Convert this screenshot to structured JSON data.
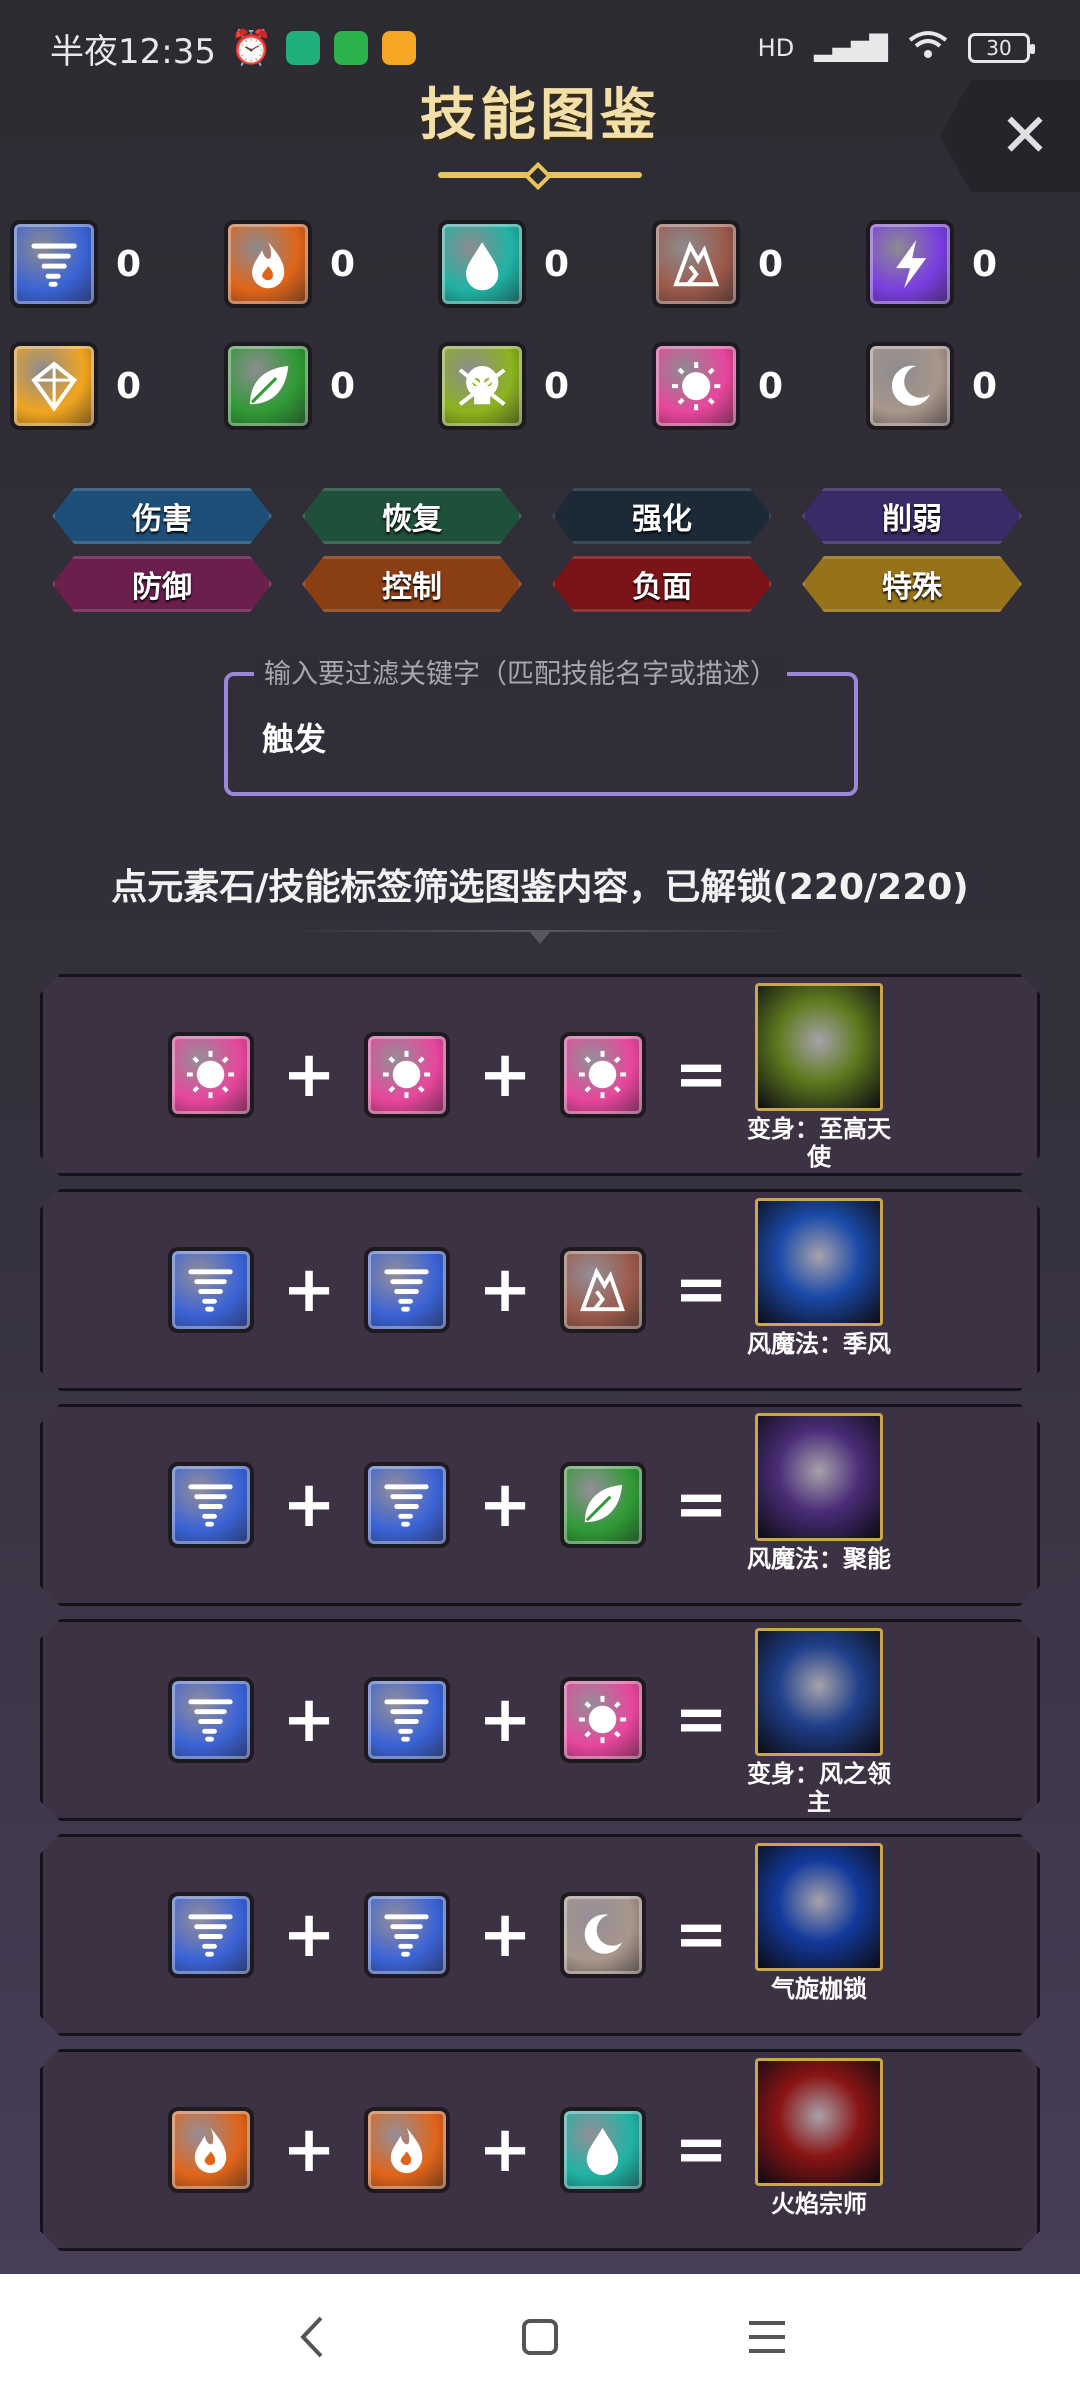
{
  "status_bar": {
    "time": "半夜12:35",
    "network": "HD",
    "battery": "30"
  },
  "header": {
    "title": "技能图鉴",
    "close_label": "✕"
  },
  "elements": [
    {
      "name": "wind",
      "count": "0",
      "color": "#3b63d6",
      "icon": "tornado-icon"
    },
    {
      "name": "fire",
      "count": "0",
      "color": "#e0651a",
      "icon": "flame-icon"
    },
    {
      "name": "water",
      "count": "0",
      "color": "#1fb3a4",
      "icon": "droplet-icon"
    },
    {
      "name": "earth",
      "count": "0",
      "color": "#9b5a4a",
      "icon": "rock-icon"
    },
    {
      "name": "thunder",
      "count": "0",
      "color": "#7a3ee0",
      "icon": "lightning-icon"
    },
    {
      "name": "light",
      "count": "0",
      "color": "#f1a51f",
      "icon": "crystal-icon"
    },
    {
      "name": "nature",
      "count": "0",
      "color": "#2f9a35",
      "icon": "leaf-icon"
    },
    {
      "name": "poison",
      "count": "0",
      "color": "#8cb31e",
      "icon": "skull-icon"
    },
    {
      "name": "holy",
      "count": "0",
      "color": "#e8469c",
      "icon": "sun-icon"
    },
    {
      "name": "dark",
      "count": "0",
      "color": "#a8968a",
      "icon": "moon-icon"
    }
  ],
  "tags": [
    {
      "label": "伤害",
      "color": "#1e4f78"
    },
    {
      "label": "恢复",
      "color": "#1f5039"
    },
    {
      "label": "强化",
      "color": "#1c2a38"
    },
    {
      "label": "削弱",
      "color": "#3a2a66"
    },
    {
      "label": "防御",
      "color": "#6a1f4d"
    },
    {
      "label": "控制",
      "color": "#8a3e14"
    },
    {
      "label": "负面",
      "color": "#7a1418"
    },
    {
      "label": "特殊",
      "color": "#96731a"
    }
  ],
  "search": {
    "legend": "输入要过滤关键字（匹配技能名字或描述）",
    "value": "触发"
  },
  "filter_info": "点元素石/技能标签筛选图鉴内容，已解锁(220/220)",
  "recipes": [
    {
      "inputs": [
        "holy",
        "holy",
        "holy"
      ],
      "result": "变身：至高天使",
      "result_color": "#5d7a1e"
    },
    {
      "inputs": [
        "wind",
        "wind",
        "earth"
      ],
      "result": "风魔法：季风",
      "result_color": "#1a4aa8"
    },
    {
      "inputs": [
        "wind",
        "wind",
        "nature"
      ],
      "result": "风魔法：聚能",
      "result_color": "#4a2d78"
    },
    {
      "inputs": [
        "wind",
        "wind",
        "holy"
      ],
      "result": "变身：风之领主",
      "result_color": "#1e3f8a"
    },
    {
      "inputs": [
        "wind",
        "wind",
        "dark"
      ],
      "result": "气旋枷锁",
      "result_color": "#123a9c"
    },
    {
      "inputs": [
        "fire",
        "fire",
        "water"
      ],
      "result": "火焰宗师",
      "result_color": "#8a1414"
    }
  ],
  "operators": {
    "plus": "+",
    "equals": "="
  }
}
